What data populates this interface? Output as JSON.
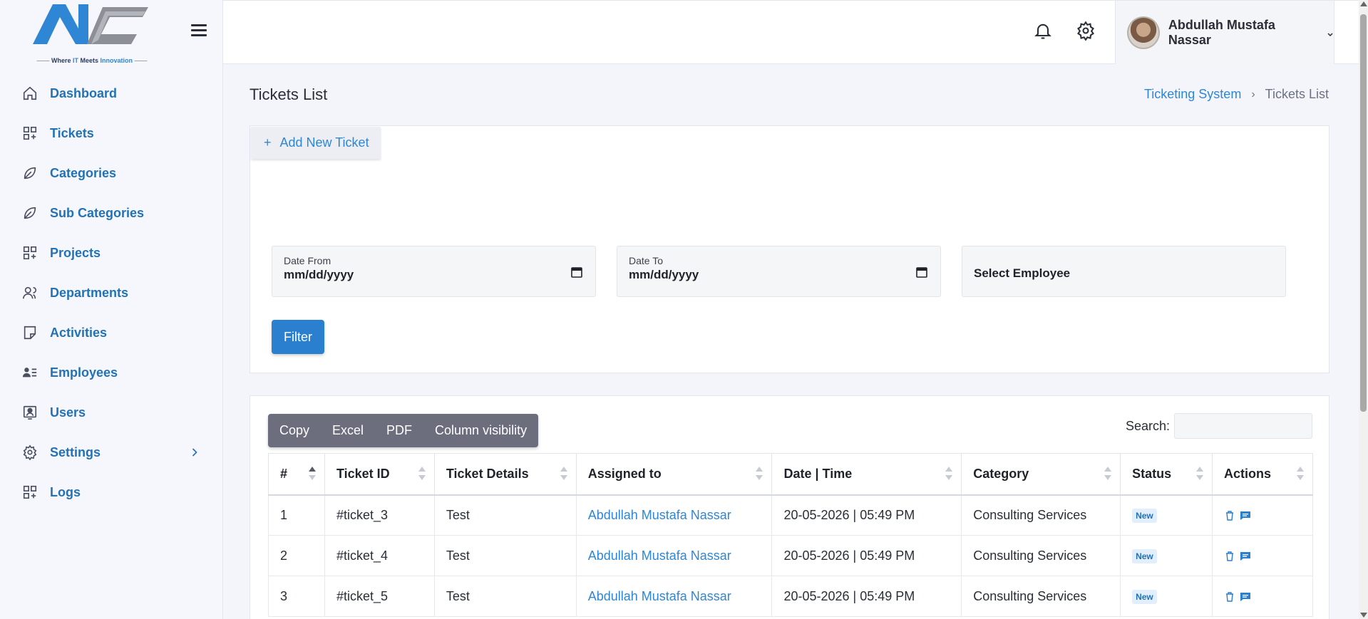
{
  "brand": {
    "tagline_a": "Where ",
    "tagline_b": "IT",
    "tagline_c": " Meets ",
    "tagline_d": "Innovation"
  },
  "sidebar": {
    "items": [
      {
        "label": "Dashboard",
        "icon": "home-icon"
      },
      {
        "label": "Tickets",
        "icon": "grid-plus-icon"
      },
      {
        "label": "Categories",
        "icon": "leaf-icon"
      },
      {
        "label": "Sub Categories",
        "icon": "leaf-icon"
      },
      {
        "label": "Projects",
        "icon": "grid-plus-icon"
      },
      {
        "label": "Departments",
        "icon": "users-icon"
      },
      {
        "label": "Activities",
        "icon": "note-icon"
      },
      {
        "label": "Employees",
        "icon": "id-list-icon"
      },
      {
        "label": "Users",
        "icon": "user-badge-icon"
      },
      {
        "label": "Settings",
        "icon": "gear-icon"
      },
      {
        "label": "Logs",
        "icon": "grid-plus-icon"
      }
    ]
  },
  "header": {
    "user_name": "Abdullah Mustafa Nassar"
  },
  "page": {
    "title": "Tickets List",
    "breadcrumb": {
      "parent": "Ticketing System",
      "current": "Tickets List"
    }
  },
  "filters": {
    "add_button": "Add New Ticket",
    "date_from_label": "Date From",
    "date_from_value": "mm/dd/yyyy",
    "date_to_label": "Date To",
    "date_to_value": "mm/dd/yyyy",
    "employee_select": "Select Employee",
    "filter_button": "Filter"
  },
  "table_tools": {
    "buttons": [
      "Copy",
      "Excel",
      "PDF",
      "Column visibility"
    ],
    "search_label": "Search:"
  },
  "table": {
    "headers": [
      "#",
      "Ticket ID",
      "Ticket Details",
      "Assigned to",
      "Date | Time",
      "Category",
      "Status",
      "Actions"
    ],
    "rows": [
      {
        "num": "1",
        "id": "#ticket_3",
        "details": "Test",
        "assigned": "Abdullah Mustafa Nassar",
        "datetime": "20-05-2026 | 05:49 PM",
        "category": "Consulting Services",
        "status": "New"
      },
      {
        "num": "2",
        "id": "#ticket_4",
        "details": "Test",
        "assigned": "Abdullah Mustafa Nassar",
        "datetime": "20-05-2026 | 05:49 PM",
        "category": "Consulting Services",
        "status": "New"
      },
      {
        "num": "3",
        "id": "#ticket_5",
        "details": "Test",
        "assigned": "Abdullah Mustafa Nassar",
        "datetime": "20-05-2026 | 05:49 PM",
        "category": "Consulting Services",
        "status": "New"
      }
    ]
  },
  "colors": {
    "accent": "#2f86d4",
    "nav_text": "#2372b5",
    "button_group": "#6c6e7e",
    "badge_bg": "#e2eefb"
  }
}
